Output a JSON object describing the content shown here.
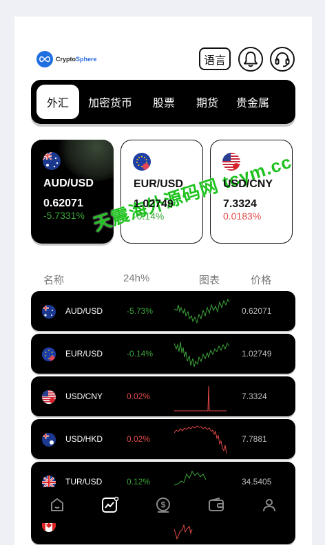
{
  "header": {
    "logo_text_prefix": "Crypto",
    "logo_text_accent": "Sphere",
    "lang_label": "语言"
  },
  "tabs": [
    {
      "label": "外汇",
      "active": true
    },
    {
      "label": "加密货币",
      "active": false
    },
    {
      "label": "股票",
      "active": false
    },
    {
      "label": "期货",
      "active": false
    },
    {
      "label": "贵金属",
      "active": false
    }
  ],
  "featured": [
    {
      "pair": "AUD/USD",
      "price": "0.62071",
      "change": "-5.7331%",
      "trend": "down"
    },
    {
      "pair": "EUR/USD",
      "price": "1.02749",
      "change": "-0.14%",
      "trend": "down"
    },
    {
      "pair": "USD/CNY",
      "price": "7.3324",
      "change": "0.0183%",
      "trend": "up"
    }
  ],
  "list_header": {
    "name": "名称",
    "change": "24h%",
    "chart": "图表",
    "price": "价格"
  },
  "rows": [
    {
      "pair": "AUD/USD",
      "change": "-5.73%",
      "price": "0.62071",
      "trend": "down"
    },
    {
      "pair": "EUR/USD",
      "change": "-0.14%",
      "price": "1.02749",
      "trend": "down"
    },
    {
      "pair": "USD/CNY",
      "change": "0.02%",
      "price": "7.3324",
      "trend": "up"
    },
    {
      "pair": "USD/HKD",
      "change": "0.02%",
      "price": "7.7881",
      "trend": "up"
    },
    {
      "pair": "TUR/USD",
      "change": "0.12%",
      "price": "34.5405",
      "trend": "down"
    }
  ],
  "nav": [
    {
      "icon": "home-icon"
    },
    {
      "icon": "market-chart-icon",
      "active": true
    },
    {
      "icon": "dollar-coin-icon"
    },
    {
      "icon": "wallet-icon"
    },
    {
      "icon": "profile-icon"
    }
  ],
  "watermark": "天震海外源码网 tcym.cc",
  "colors": {
    "negative": "#3ca43a",
    "positive": "#e24a4a",
    "accent": "#2b6be3"
  }
}
